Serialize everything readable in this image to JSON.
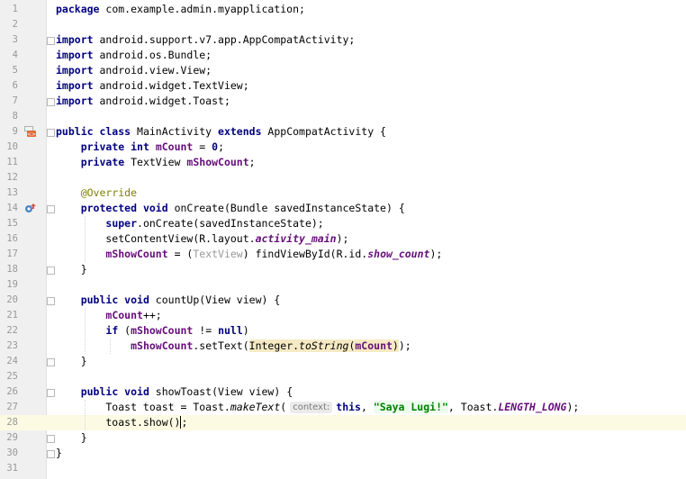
{
  "editor": {
    "current_line": 28,
    "lines": [
      {
        "n": "1",
        "tokens": [
          {
            "t": "package",
            "c": "kw"
          },
          {
            "t": " com.example.admin.myapplication;",
            "c": ""
          }
        ]
      },
      {
        "n": "2",
        "tokens": []
      },
      {
        "n": "3",
        "tokens": [
          {
            "t": "import",
            "c": "kw"
          },
          {
            "t": " android.support.v7.app.AppCompatActivity;",
            "c": ""
          }
        ]
      },
      {
        "n": "4",
        "tokens": [
          {
            "t": "import",
            "c": "kw"
          },
          {
            "t": " android.os.Bundle;",
            "c": ""
          }
        ]
      },
      {
        "n": "5",
        "tokens": [
          {
            "t": "import",
            "c": "kw"
          },
          {
            "t": " android.view.View;",
            "c": ""
          }
        ]
      },
      {
        "n": "6",
        "tokens": [
          {
            "t": "import",
            "c": "kw"
          },
          {
            "t": " android.widget.TextView;",
            "c": ""
          }
        ]
      },
      {
        "n": "7",
        "tokens": [
          {
            "t": "import",
            "c": "kw"
          },
          {
            "t": " android.widget.Toast;",
            "c": ""
          }
        ]
      },
      {
        "n": "8",
        "tokens": []
      },
      {
        "n": "9",
        "tokens": [
          {
            "t": "public class",
            "c": "kw"
          },
          {
            "t": " MainActivity ",
            "c": ""
          },
          {
            "t": "extends",
            "c": "kw"
          },
          {
            "t": " AppCompatActivity {",
            "c": ""
          }
        ]
      },
      {
        "n": "10",
        "tokens": [
          {
            "t": "    ",
            "c": ""
          },
          {
            "t": "private int",
            "c": "kw"
          },
          {
            "t": " ",
            "c": ""
          },
          {
            "t": "mCount",
            "c": "field"
          },
          {
            "t": " = ",
            "c": ""
          },
          {
            "t": "0",
            "c": "kw"
          },
          {
            "t": ";",
            "c": ""
          }
        ]
      },
      {
        "n": "11",
        "tokens": [
          {
            "t": "    ",
            "c": ""
          },
          {
            "t": "private",
            "c": "kw"
          },
          {
            "t": " TextView ",
            "c": ""
          },
          {
            "t": "mShowCount",
            "c": "field"
          },
          {
            "t": ";",
            "c": ""
          }
        ]
      },
      {
        "n": "12",
        "tokens": []
      },
      {
        "n": "13",
        "tokens": [
          {
            "t": "    ",
            "c": ""
          },
          {
            "t": "@Override",
            "c": "ann"
          }
        ]
      },
      {
        "n": "14",
        "tokens": [
          {
            "t": "    ",
            "c": ""
          },
          {
            "t": "protected void",
            "c": "kw"
          },
          {
            "t": " onCreate(Bundle savedInstanceState) {",
            "c": ""
          }
        ]
      },
      {
        "n": "15",
        "tokens": [
          {
            "t": "        ",
            "c": ""
          },
          {
            "t": "super",
            "c": "kw"
          },
          {
            "t": ".onCreate(savedInstanceState);",
            "c": ""
          }
        ]
      },
      {
        "n": "16",
        "tokens": [
          {
            "t": "        setContentView(R.layout.",
            "c": ""
          },
          {
            "t": "activity_main",
            "c": "fieldi"
          },
          {
            "t": ");",
            "c": ""
          }
        ]
      },
      {
        "n": "17",
        "tokens": [
          {
            "t": "        ",
            "c": ""
          },
          {
            "t": "mShowCount",
            "c": "field"
          },
          {
            "t": " = (",
            "c": ""
          },
          {
            "t": "TextView",
            "c": "gray"
          },
          {
            "t": ") findViewById(R.id.",
            "c": ""
          },
          {
            "t": "show_count",
            "c": "fieldi"
          },
          {
            "t": ");",
            "c": ""
          }
        ]
      },
      {
        "n": "18",
        "tokens": [
          {
            "t": "    }",
            "c": ""
          }
        ]
      },
      {
        "n": "19",
        "tokens": []
      },
      {
        "n": "20",
        "tokens": [
          {
            "t": "    ",
            "c": ""
          },
          {
            "t": "public void",
            "c": "kw"
          },
          {
            "t": " countUp(View view) {",
            "c": ""
          }
        ]
      },
      {
        "n": "21",
        "tokens": [
          {
            "t": "        ",
            "c": ""
          },
          {
            "t": "mCount",
            "c": "field"
          },
          {
            "t": "++;",
            "c": ""
          }
        ]
      },
      {
        "n": "22",
        "tokens": [
          {
            "t": "        ",
            "c": ""
          },
          {
            "t": "if",
            "c": "kw"
          },
          {
            "t": " (",
            "c": ""
          },
          {
            "t": "mShowCount",
            "c": "field"
          },
          {
            "t": " != ",
            "c": ""
          },
          {
            "t": "null",
            "c": "kw"
          },
          {
            "t": ")",
            "c": ""
          }
        ]
      },
      {
        "n": "23",
        "tokens": [
          {
            "t": "            ",
            "c": ""
          },
          {
            "t": "mShowCount",
            "c": "field"
          },
          {
            "t": ".setText(",
            "c": ""
          },
          {
            "t": "Integer.",
            "c": "hl"
          },
          {
            "t": "toString",
            "c": "hl ital"
          },
          {
            "t": "(",
            "c": "hl"
          },
          {
            "t": "mCount",
            "c": "hl field"
          },
          {
            "t": ")",
            "c": "hl"
          },
          {
            "t": ");",
            "c": ""
          }
        ]
      },
      {
        "n": "24",
        "tokens": [
          {
            "t": "    }",
            "c": ""
          }
        ]
      },
      {
        "n": "25",
        "tokens": []
      },
      {
        "n": "26",
        "tokens": [
          {
            "t": "    ",
            "c": ""
          },
          {
            "t": "public void",
            "c": "kw"
          },
          {
            "t": " showToast(View view) {",
            "c": ""
          }
        ]
      },
      {
        "n": "27",
        "tokens": [
          {
            "t": "        Toast toast = Toast.",
            "c": ""
          },
          {
            "t": "makeText",
            "c": "ital"
          },
          {
            "t": "(",
            "c": ""
          },
          {
            "t": "context:",
            "c": "hint"
          },
          {
            "t": "this",
            "c": "kw"
          },
          {
            "t": ", ",
            "c": ""
          },
          {
            "t": "\"Saya Lugi!\"",
            "c": "str"
          },
          {
            "t": ", Toast.",
            "c": ""
          },
          {
            "t": "LENGTH_LONG",
            "c": "fieldi"
          },
          {
            "t": ");",
            "c": ""
          }
        ]
      },
      {
        "n": "28",
        "tokens": [
          {
            "t": "        toast.show()",
            "c": ""
          },
          {
            "t": "",
            "c": "caret"
          },
          {
            "t": ";",
            "c": ""
          }
        ]
      },
      {
        "n": "29",
        "tokens": [
          {
            "t": "    }",
            "c": ""
          }
        ]
      },
      {
        "n": "30",
        "tokens": [
          {
            "t": "}",
            "c": ""
          }
        ]
      },
      {
        "n": "31",
        "tokens": []
      }
    ]
  },
  "gutter_icons": [
    {
      "line": "9",
      "icon": "class-layout-icon"
    },
    {
      "line": "14",
      "icon": "override-method-icon"
    }
  ]
}
